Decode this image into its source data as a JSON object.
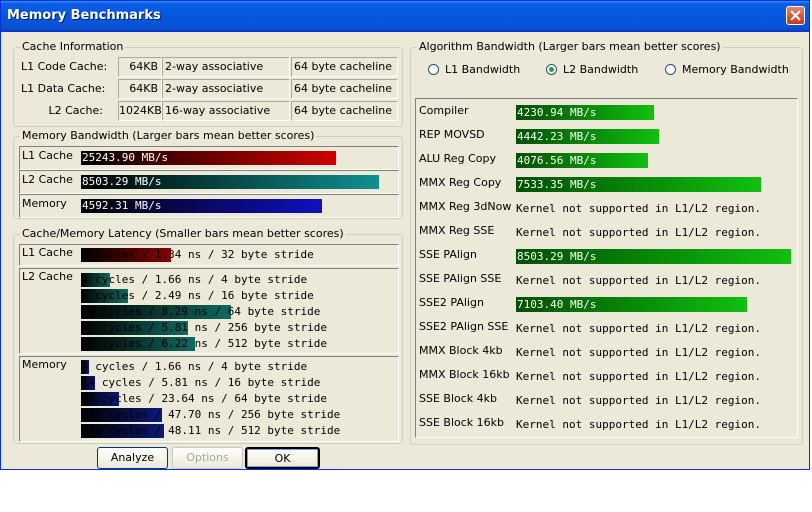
{
  "window": {
    "title": "Memory Benchmarks"
  },
  "cache_info": {
    "label": "Cache Information",
    "rows": [
      {
        "name": "L1 Code Cache:",
        "size": "64KB",
        "assoc": "2-way associative",
        "line": "64 byte cacheline"
      },
      {
        "name": "L1 Data Cache:",
        "size": "64KB",
        "assoc": "2-way associative",
        "line": "64 byte cacheline"
      },
      {
        "name": "L2 Cache:",
        "size": "1024KB",
        "assoc": "16-way associative",
        "line": "64 byte cacheline"
      }
    ]
  },
  "mem_bw": {
    "label": "Memory Bandwidth (Larger bars mean better scores)",
    "rows": [
      {
        "name": "L1 Cache",
        "value": "25243.90 MB/s",
        "fraction": 0.855,
        "color": "#d00000"
      },
      {
        "name": "L2 Cache",
        "value": "8503.29 MB/s",
        "fraction": 1.0,
        "color": "#109090"
      },
      {
        "name": "Memory",
        "value": "4592.31 MB/s",
        "fraction": 0.81,
        "color": "#1010c0"
      }
    ]
  },
  "latency": {
    "label": "Cache/Memory Latency (Smaller bars mean better scores)",
    "groups": [
      {
        "name": "L1 Cache",
        "color": "#8a0000",
        "rows": [
          {
            "text": "3 cycles / 1.34 ns / 32 byte stride",
            "fraction": 0.3
          }
        ]
      },
      {
        "name": "L2 Cache",
        "color": "#0f6a60",
        "rows": [
          {
            "text": "4 cycles / 1.66 ns / 4 byte stride",
            "fraction": 0.095
          },
          {
            "text": "6 cycles / 2.49 ns / 16 byte stride",
            "fraction": 0.155
          },
          {
            "text": "20 cycles / 8.29 ns / 64 byte stride",
            "fraction": 0.5
          },
          {
            "text": "14 cycles / 5.81 ns / 256 byte stride",
            "fraction": 0.355
          },
          {
            "text": "15 cycles / 6.22 ns / 512 byte stride",
            "fraction": 0.38
          }
        ]
      },
      {
        "name": "Memory",
        "color": "#0a1a78",
        "rows": [
          {
            "text": "4 cycles / 1.66 ns / 4 byte stride",
            "fraction": 0.025
          },
          {
            "text": "14 cycles / 5.81 ns / 16 byte stride",
            "fraction": 0.045
          },
          {
            "text": "57 cycles / 23.64 ns / 64 byte stride",
            "fraction": 0.125
          },
          {
            "text": "115 cycles / 47.70 ns / 256 byte stride",
            "fraction": 0.27
          },
          {
            "text": "116 cycles / 48.11 ns / 512 byte stride",
            "fraction": 0.275
          }
        ]
      }
    ]
  },
  "algo_bw": {
    "label": "Algorithm Bandwidth (Larger bars mean better scores)",
    "options": [
      {
        "label": "L1 Bandwidth",
        "selected": false
      },
      {
        "label": "L2 Bandwidth",
        "selected": true
      },
      {
        "label": "Memory Bandwidth",
        "selected": false
      }
    ],
    "unsupported_text": "Kernel not supported in L1/L2 region.",
    "rows": [
      {
        "name": "Compiler",
        "value": "4230.94 MB/s",
        "fraction": 0.5
      },
      {
        "name": "REP MOVSD",
        "value": "4442.23 MB/s",
        "fraction": 0.52
      },
      {
        "name": "ALU Reg Copy",
        "value": "4076.56 MB/s",
        "fraction": 0.48
      },
      {
        "name": "MMX Reg Copy",
        "value": "7533.35 MB/s",
        "fraction": 0.89
      },
      {
        "name": "MMX Reg 3dNow",
        "value": null,
        "fraction": 0
      },
      {
        "name": "MMX Reg SSE",
        "value": null,
        "fraction": 0
      },
      {
        "name": "SSE PAlign",
        "value": "8503.29 MB/s",
        "fraction": 1.0
      },
      {
        "name": "SSE PAlign SSE",
        "value": null,
        "fraction": 0
      },
      {
        "name": "SSE2 PAlign",
        "value": "7103.40 MB/s",
        "fraction": 0.84
      },
      {
        "name": "SSE2 PAlign SSE",
        "value": null,
        "fraction": 0
      },
      {
        "name": "MMX Block 4kb",
        "value": null,
        "fraction": 0
      },
      {
        "name": "MMX Block 16kb",
        "value": null,
        "fraction": 0
      },
      {
        "name": "SSE Block 4kb",
        "value": null,
        "fraction": 0
      },
      {
        "name": "SSE Block 16kb",
        "value": null,
        "fraction": 0
      }
    ]
  },
  "buttons": {
    "analyze": "Analyze",
    "options": "Options",
    "ok": "OK"
  }
}
